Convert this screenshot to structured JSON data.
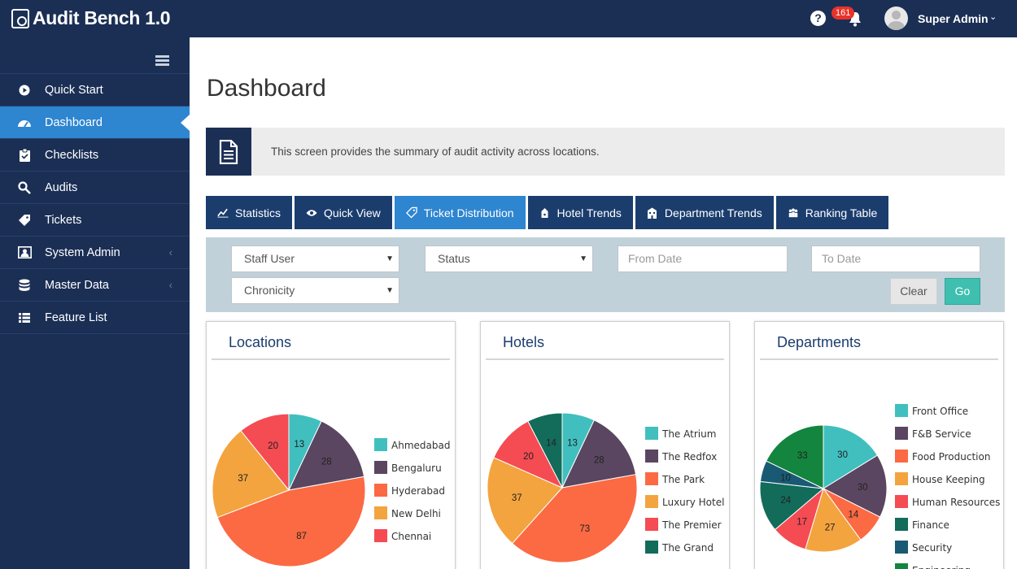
{
  "app": {
    "title": "Audit Bench 1.0"
  },
  "header": {
    "notification_count": "161",
    "user_name": "Super Admin",
    "user_caret": "⌄"
  },
  "sidebar": {
    "items": [
      {
        "label": "Quick Start",
        "icon": "play-circle-icon",
        "active": false,
        "submenu": false
      },
      {
        "label": "Dashboard",
        "icon": "dashboard-gauge-icon",
        "active": true,
        "submenu": false
      },
      {
        "label": "Checklists",
        "icon": "clipboard-icon",
        "active": false,
        "submenu": false
      },
      {
        "label": "Audits",
        "icon": "search-icon",
        "active": false,
        "submenu": false
      },
      {
        "label": "Tickets",
        "icon": "tag-icon",
        "active": false,
        "submenu": false
      },
      {
        "label": "System Admin",
        "icon": "admin-icon",
        "active": false,
        "submenu": true
      },
      {
        "label": "Master Data",
        "icon": "database-icon",
        "active": false,
        "submenu": true
      },
      {
        "label": "Feature List",
        "icon": "list-icon",
        "active": false,
        "submenu": false
      }
    ],
    "submenu_chevron": "‹"
  },
  "main": {
    "page_title": "Dashboard",
    "info_text": "This screen provides the summary of audit activity across locations.",
    "tabs": [
      {
        "label": "Statistics",
        "icon": "line-chart-icon",
        "active": false
      },
      {
        "label": "Quick View",
        "icon": "eye-icon",
        "active": false
      },
      {
        "label": "Ticket Distribution",
        "icon": "ticket-icon",
        "active": true
      },
      {
        "label": "Hotel Trends",
        "icon": "bell-hop-icon",
        "active": false
      },
      {
        "label": "Department Trends",
        "icon": "building-icon",
        "active": false
      },
      {
        "label": "Ranking Table",
        "icon": "users-icon",
        "active": false
      }
    ],
    "filters": {
      "staff_user": "Staff User",
      "status": "Status",
      "from_date_placeholder": "From Date",
      "to_date_placeholder": "To Date",
      "chronicity": "Chronicity",
      "clear_label": "Clear",
      "go_label": "Go",
      "caret": "▼"
    }
  },
  "colors": {
    "teal": "#41bfbf",
    "plum": "#5a4660",
    "coral": "#fb6a43",
    "amber": "#f3a43e",
    "red": "#f54b53",
    "green": "#136b5a",
    "petrol": "#185a73",
    "forest": "#13853e"
  },
  "chart_data": [
    {
      "type": "pie",
      "title": "Locations",
      "categories": [
        "Ahmedabad",
        "Bengaluru",
        "Hyderabad",
        "New Delhi",
        "Chennai"
      ],
      "values": [
        13,
        28,
        87,
        37,
        20
      ],
      "colors": [
        "#41bfbf",
        "#5a4660",
        "#fb6a43",
        "#f3a43e",
        "#f54b53"
      ],
      "legend": "right"
    },
    {
      "type": "pie",
      "title": "Hotels",
      "categories": [
        "The Atrium",
        "The Redfox",
        "The Park",
        "Luxury Hotel",
        "The Premier",
        "The Grand"
      ],
      "values": [
        13,
        28,
        73,
        37,
        20,
        14
      ],
      "colors": [
        "#41bfbf",
        "#5a4660",
        "#fb6a43",
        "#f3a43e",
        "#f54b53",
        "#136b5a"
      ],
      "legend": "right"
    },
    {
      "type": "pie",
      "title": "Departments",
      "categories": [
        "Front Office",
        "F&B Service",
        "Food Production",
        "House Keeping",
        "Human Resources",
        "Finance",
        "Security",
        "Engineering"
      ],
      "values": [
        30,
        30,
        14,
        27,
        17,
        24,
        10,
        33
      ],
      "colors": [
        "#41bfbf",
        "#5a4660",
        "#fb6a43",
        "#f3a43e",
        "#f54b53",
        "#136b5a",
        "#185a73",
        "#13853e"
      ],
      "legend": "right"
    }
  ]
}
